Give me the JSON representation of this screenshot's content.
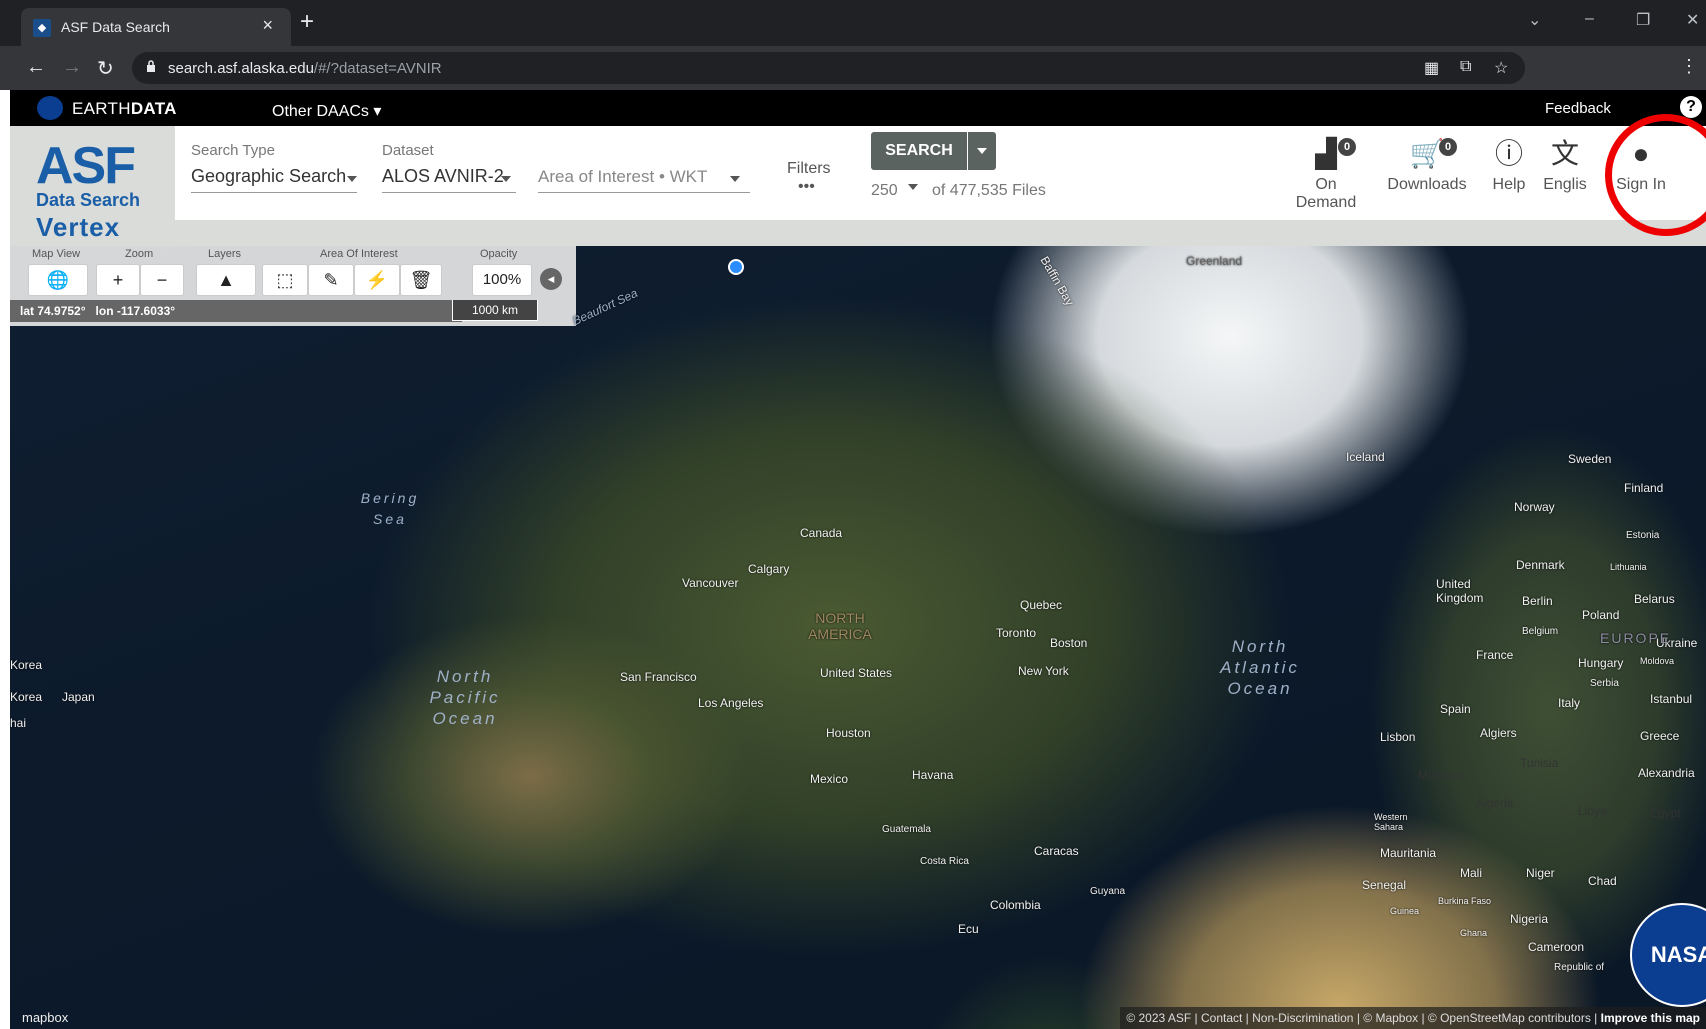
{
  "browser": {
    "tab_title": "ASF Data Search",
    "url_host": "search.asf.alaska.edu",
    "url_path": "/#/?dataset=AVNIR"
  },
  "earthdata": {
    "brand_plain": "EARTH",
    "brand_bold": "DATA",
    "other_daacs": "Other DAACs ▾",
    "feedback": "Feedback",
    "help": "?"
  },
  "logo": {
    "asf": "ASF",
    "data_search": "Data Search",
    "vertex": "Vertex"
  },
  "search": {
    "search_type_label": "Search Type",
    "search_type_value": "Geographic Search",
    "dataset_label": "Dataset",
    "dataset_value": "ALOS AVNIR-2",
    "aoi_placeholder": "Area of Interest • WKT",
    "filters_label": "Filters",
    "filters_dots": "•••",
    "search_button": "SEARCH",
    "max_results": "250",
    "file_count": "of 477,535 Files"
  },
  "toolbar": {
    "on_demand": {
      "label": "On Demand",
      "badge": "0"
    },
    "downloads": {
      "label": "Downloads",
      "badge": "0"
    },
    "help": {
      "label": "Help"
    },
    "language": {
      "label": "Englis"
    },
    "sign_in": {
      "label": "Sign In"
    }
  },
  "map_controls": {
    "map_view": "Map View",
    "zoom": "Zoom",
    "layers": "Layers",
    "area_of_interest": "Area Of Interest",
    "opacity": "Opacity",
    "opacity_value": "100%",
    "lat": "lat 74.9752°",
    "lon": "lon -117.6033°",
    "scale": "1000 km"
  },
  "map_labels": {
    "greenland": "Greenland",
    "baffin_bay": "Baffin Bay",
    "beaufort_sea": "Beaufort Sea",
    "iceland": "Iceland",
    "sweden": "Sweden",
    "finland": "Finland",
    "norway": "Norway",
    "estonia": "Estonia",
    "denmark": "Denmark",
    "lithuania": "Lithuania",
    "united_kingdom": "United Kingdom",
    "berlin": "Berlin",
    "poland": "Poland",
    "belarus": "Belarus",
    "belgium": "Belgium",
    "ukraine": "Ukraine",
    "france": "France",
    "hungary": "Hungary",
    "moldova": "Moldova",
    "serbia": "Serbia",
    "istanbul": "Istanbul",
    "italy": "Italy",
    "spain": "Spain",
    "greece": "Greece",
    "lisbon": "Lisbon",
    "algiers": "Algiers",
    "tunisia": "Tunisia",
    "morocco": "Morocco",
    "alexandria": "Alexandria",
    "algeria": "Algeria",
    "libya": "Libya",
    "egypt": "Egypt",
    "western_sahara": "Western Sahara",
    "mauritania": "Mauritania",
    "mali": "Mali",
    "niger": "Niger",
    "chad": "Chad",
    "senegal": "Senegal",
    "burkina_faso": "Burkina Faso",
    "guinea": "Guinea",
    "ghana": "Ghana",
    "nigeria": "Nigeria",
    "cameroon": "Cameroon",
    "republic_of": "Republic of",
    "bering_sea": "Bering Sea",
    "canada": "Canada",
    "calgary": "Calgary",
    "vancouver": "Vancouver",
    "quebec": "Quebec",
    "toronto": "Toronto",
    "boston": "Boston",
    "new_york": "New York",
    "north_america": "NORTH AMERICA",
    "united_states": "United States",
    "san_francisco": "San Francisco",
    "los_angeles": "Los Angeles",
    "houston": "Houston",
    "mexico": "Mexico",
    "havana": "Havana",
    "guatemala": "Guatemala",
    "costa_rica": "Costa Rica",
    "caracas": "Caracas",
    "guyana": "Guyana",
    "colombia": "Colombia",
    "ecu": "Ecu",
    "korea": "Korea",
    "n_korea": "Korea",
    "japan": "Japan",
    "hai": "hai",
    "north_pacific": "North Pacific Ocean",
    "north_atlantic": "North Atlantic Ocean",
    "europe": "EUROPE"
  },
  "attribution": {
    "text": "© 2023 ASF  |  Contact  |  Non-Discrimination  |  © Mapbox  |  © OpenStreetMap contributors  |",
    "improve": "Improve this map",
    "mapbox": "mapbox",
    "nasa": "NASA"
  }
}
